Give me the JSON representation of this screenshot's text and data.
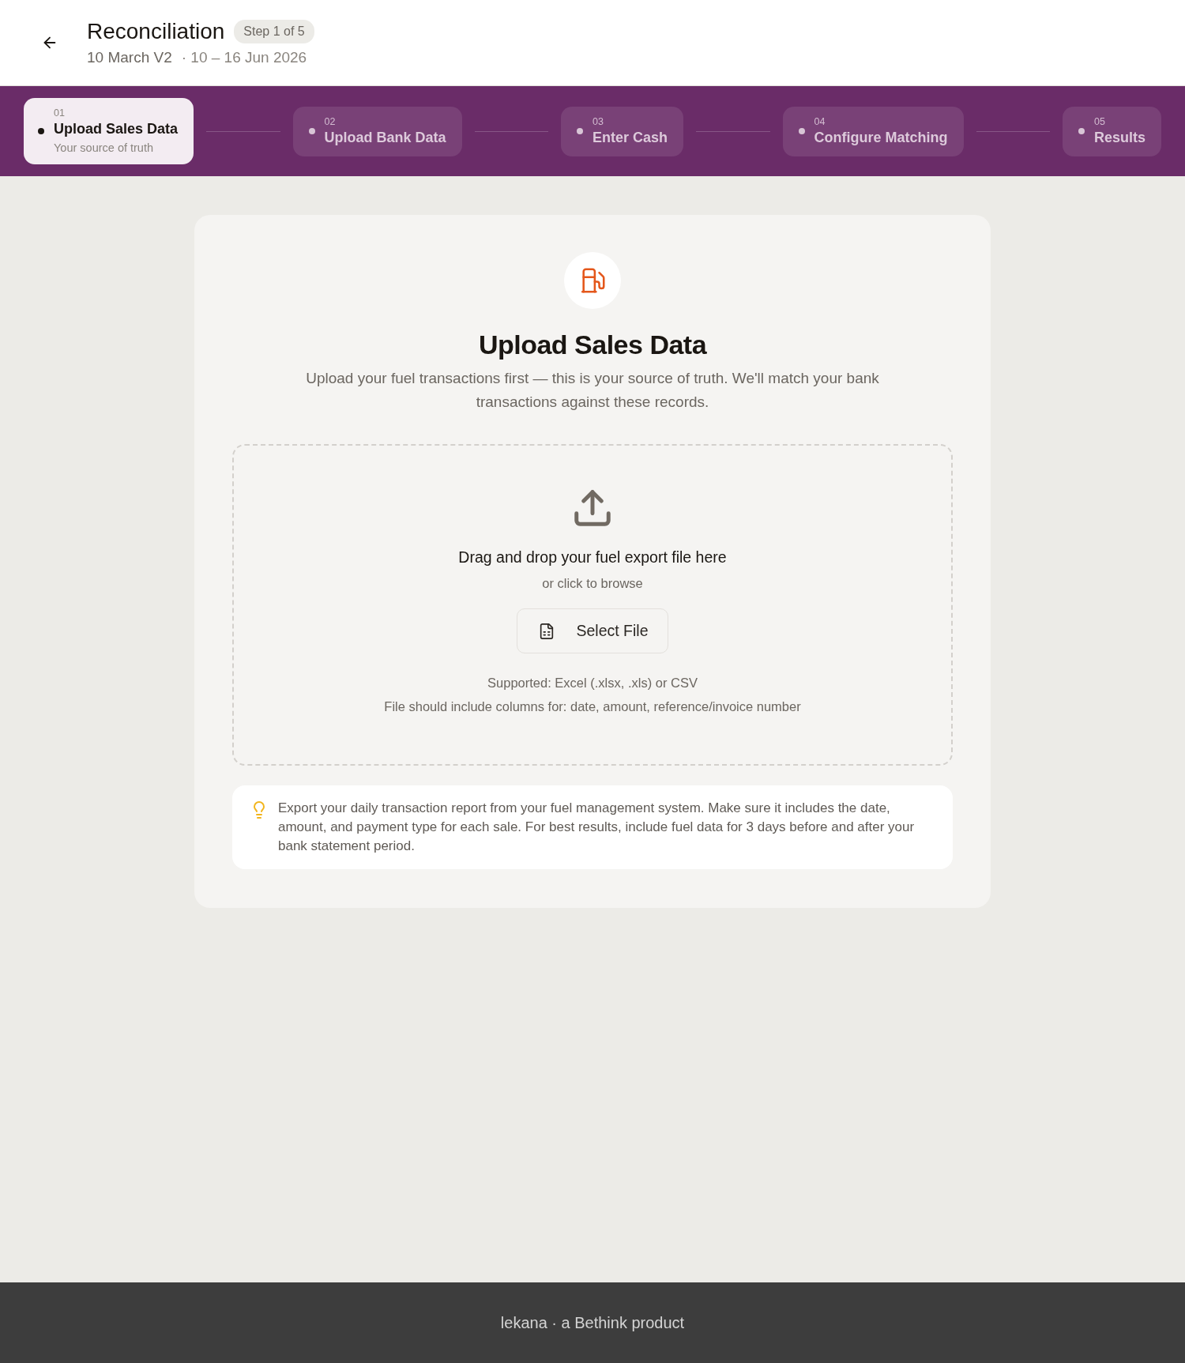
{
  "header": {
    "title": "Reconciliation",
    "badge": "Step 1 of 5",
    "subtitle": "10 March V2",
    "date_range": "· 10 – 16 Jun 2026"
  },
  "steps": [
    {
      "number": "01",
      "label": "Upload Sales Data",
      "caption": "Your source of truth",
      "selected": true
    },
    {
      "number": "02",
      "label": "Upload Bank Data",
      "selected": false
    },
    {
      "number": "03",
      "label": "Enter Cash",
      "selected": false
    },
    {
      "number": "04",
      "label": "Configure Matching",
      "selected": false
    },
    {
      "number": "05",
      "label": "Results",
      "selected": false
    }
  ],
  "card": {
    "title": "Upload Sales Data",
    "description": "Upload your fuel transactions first — this is your source of truth. We'll match your bank transactions against these records.",
    "dropzone": {
      "heading": "Drag and drop your fuel export file here",
      "hint": "or click to browse",
      "button": "Select File",
      "notes": [
        "Supported: Excel (.xlsx, .xls) or CSV",
        "File should include columns for: date, amount, reference/invoice number"
      ]
    },
    "tip": "Export your daily transaction report from your fuel management system. Make sure it includes the date, amount, and payment type for each sale. For best results, include fuel data for 3 days before and after your bank statement period."
  },
  "footer": "lekana · a Bethink product"
}
